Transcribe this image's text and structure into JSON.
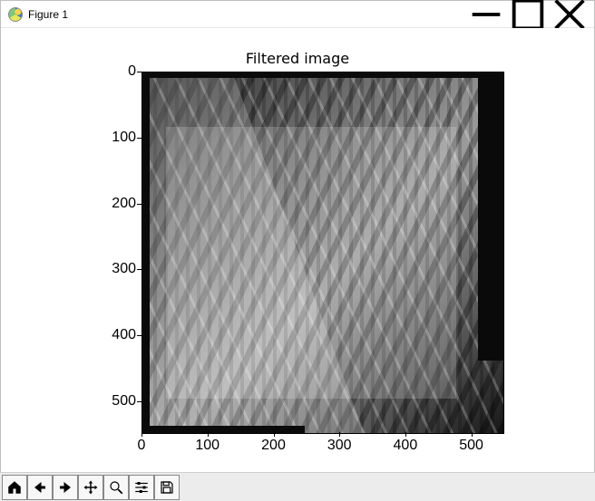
{
  "window": {
    "title": "Figure 1"
  },
  "chart_data": {
    "type": "heatmap",
    "title": "Filtered image",
    "xlabel": "",
    "ylabel": "",
    "xlim": [
      0,
      550
    ],
    "ylim": [
      550,
      0
    ],
    "x_ticks": [
      0,
      100,
      200,
      300,
      400,
      500
    ],
    "y_ticks": [
      0,
      100,
      200,
      300,
      400,
      500
    ],
    "description": "Grayscale photographic image (approx. 550×550) of architectural metal staircase structure, displayed via imshow with origin at top-left; a filtered (brightened) sub-region is overlaid.",
    "values": null
  },
  "ticks": {
    "x": [
      "0",
      "100",
      "200",
      "300",
      "400",
      "500"
    ],
    "y": [
      "0",
      "100",
      "200",
      "300",
      "400",
      "500"
    ]
  },
  "toolbar": {
    "home": "Home",
    "back": "Back",
    "forward": "Forward",
    "pan": "Pan",
    "zoom": "Zoom",
    "subplots": "Configure subplots",
    "save": "Save"
  },
  "window_controls": {
    "minimize": "Minimize",
    "maximize": "Maximize",
    "close": "Close"
  }
}
